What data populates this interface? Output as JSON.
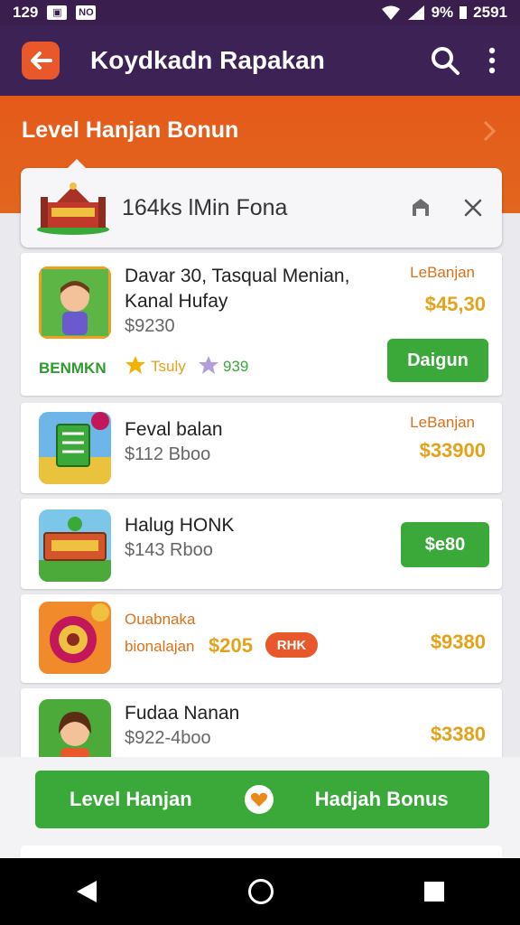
{
  "status_bar": {
    "time": "129",
    "icon_1": "image-icon",
    "icon_2": "NO",
    "battery": "9%",
    "clock_right": "2591"
  },
  "app_bar": {
    "title": "Koydkadn Rapakan"
  },
  "banner": {
    "title": "Level Hanjan Bonun"
  },
  "search": {
    "value": "164ks lMin Fona"
  },
  "items": [
    {
      "title_line1": "Davar 30, Tasqual Menian,",
      "title_line2": "Kanal Hufay",
      "price": "$9230",
      "badge": "BENMKN",
      "rating1": "Tsuly",
      "rating2": "939",
      "tag": "LeBanjan",
      "amount": "$45,30",
      "button": "Daigun"
    },
    {
      "title": "Feval balan",
      "price": "$112 Bboo",
      "tag": "LeBanjan",
      "amount": "$33900"
    },
    {
      "title": "Halug HONK",
      "price": "$143 Rboo",
      "button": "$e80"
    },
    {
      "title": "Ouabnaka",
      "subtitle": "bionalajan",
      "price": "$205",
      "badge": "RHK",
      "amount": "$9380"
    },
    {
      "title": "Fudaa Nanan",
      "price": "$922-4boo",
      "amount": "$3380"
    }
  ],
  "bottom_bar": {
    "left_label": "Level Hanjan",
    "right_label": "Hadjah Bonus"
  },
  "colors": {
    "app_bar": "#3d2256",
    "banner": "#e55a1a",
    "green": "#3aa93a",
    "amount": "#e3a21a"
  }
}
